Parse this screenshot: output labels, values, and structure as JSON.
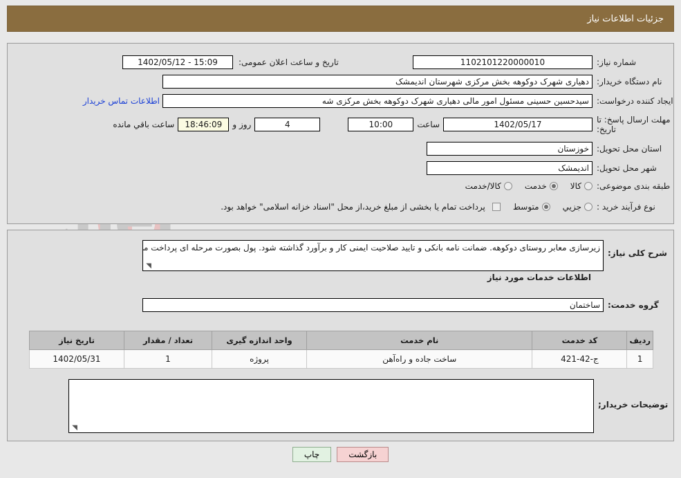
{
  "header": {
    "title": "جزئیات اطلاعات نیاز"
  },
  "need_info": {
    "need_number_label": "شماره نیاز:",
    "need_number_value": "1102101220000010",
    "announce_datetime_label": "تاریخ و ساعت اعلان عمومی:",
    "announce_datetime_value": "15:09 - 1402/05/12",
    "buyer_org_label": "نام دستگاه خریدار:",
    "buyer_org_value": "دهیاری شهرک دوکوهه بخش مرکزی شهرستان اندیمشک",
    "requester_label": "ایجاد کننده درخواست:",
    "requester_value": "سیدحسین حسینی مسئول امور مالی دهیاری شهرک دوکوهه بخش مرکزی شه",
    "buyer_contact_link": "اطلاعات تماس خریدار",
    "deadline_label_line1": "مهلت ارسال پاسخ: تا",
    "deadline_label_line2": "تاریخ:",
    "deadline_date_value": "1402/05/17",
    "deadline_hour_word": "ساعت",
    "deadline_time_value": "10:00",
    "remaining_days_value": "4",
    "remaining_days_word": "روز و",
    "remaining_clock_value": "18:46:09",
    "remaining_suffix": "ساعت باقي مانده",
    "province_label": "استان محل تحویل:",
    "province_value": "خوزستان",
    "city_label": "شهر محل تحویل:",
    "city_value": "اندیمشک",
    "classification_label": "طبقه بندی موضوعی:",
    "classification_options": [
      {
        "label": "کالا",
        "selected": false
      },
      {
        "label": "خدمت",
        "selected": true
      },
      {
        "label": "کالا/خدمت",
        "selected": false
      }
    ],
    "process_type_label": "نوع فرآیند خرید :",
    "process_type_options": [
      {
        "label": "جزیي",
        "selected": false
      },
      {
        "label": "متوسط",
        "selected": true
      }
    ],
    "treasury_checkbox_checked": false,
    "treasury_note": "پرداخت تمام یا بخشی از مبلغ خرید،از محل \"اسناد خزانه اسلامی\" خواهد بود."
  },
  "description": {
    "label": "شرح کلی نیاز:",
    "value": "زیرسازی معابر روستای دوکوهه. ضمانت نامه بانکی و تایید صلاحیت ایمنی کار و برآورد گذاشته شود. پول بصورت مرحله ای پرداخت می شود"
  },
  "services_section": {
    "caption": "اطلاعات خدمات مورد نیاز",
    "service_group_label": "گروه خدمت:",
    "service_group_value": "ساختمان",
    "table": {
      "columns": [
        "ردیف",
        "کد خدمت",
        "نام خدمت",
        "واحد اندازه گیری",
        "تعداد / مقدار",
        "تاریخ نیاز"
      ],
      "rows": [
        {
          "row_no": "1",
          "service_code": "ج-42-421",
          "service_name": "ساخت جاده و راه‌آهن",
          "unit": "پروژه",
          "quantity": "1",
          "need_date": "1402/05/31"
        }
      ]
    }
  },
  "buyer_notes": {
    "label": "توضیحات خریدار;",
    "value": "",
    "placeholder": ""
  },
  "footer_buttons": {
    "back_label": "بازگشت",
    "print_label": "چاپ"
  },
  "watermark": {
    "text": "AriaTender.net"
  },
  "colors": {
    "header_brown": "#8a6d3f",
    "page_background": "#e8e8e8",
    "panel_background": "#e0e0e0",
    "link_blue": "#1a3fd6",
    "back_button_pink": "#f6d2d2",
    "print_button_green": "#e2f2e2",
    "countdown_cream": "#fbfbe2",
    "table_header_gray": "#c3c3c3"
  }
}
